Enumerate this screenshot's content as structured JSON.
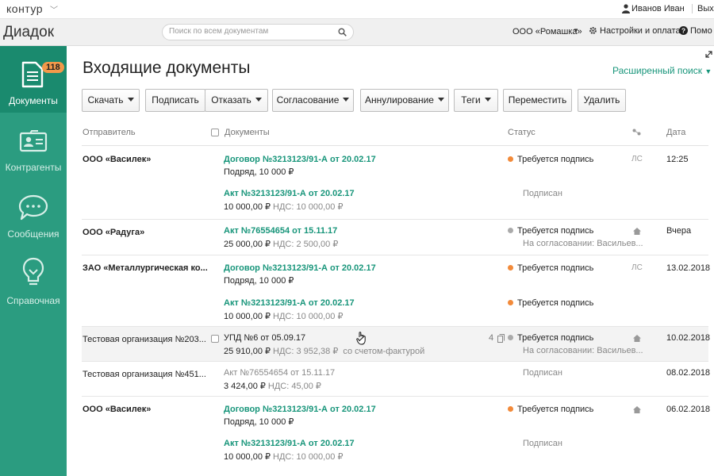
{
  "topbar": {
    "logo": "контур",
    "user_name": "Иванов Иван",
    "exit_label": "Выхо"
  },
  "appbar": {
    "brand": "Диадок",
    "search_placeholder": "Поиск по всем документам",
    "organization": "ООО «Ромашка»",
    "settings_label": "Настройки и оплата",
    "help_label": "Помо"
  },
  "sidebar": {
    "items": [
      {
        "label": "Документы",
        "badge": "118",
        "icon": "document-icon"
      },
      {
        "label": "Контрагенты",
        "icon": "id-card-icon"
      },
      {
        "label": "Сообщения",
        "icon": "chat-bubble-icon"
      },
      {
        "label": "Справочная",
        "icon": "lightbulb-icon"
      }
    ]
  },
  "page": {
    "title": "Входящие документы",
    "advanced_search": "Расширенный поиск"
  },
  "toolbar": {
    "download": "Скачать",
    "sign": "Подписать",
    "reject": "Отказать",
    "approval": "Согласование",
    "annulment": "Аннулирование",
    "tags": "Теги",
    "move": "Переместить",
    "delete": "Удалить"
  },
  "table": {
    "headers": {
      "sender": "Отправитель",
      "documents": "Документы",
      "status": "Статус",
      "date": "Дата"
    },
    "rows": [
      {
        "sender": "ООО «Василек»",
        "date": "12:25",
        "ls": "ЛС",
        "docs": [
          {
            "title": "Договор №3213123/91-А от 20.02.17",
            "sub": "Подряд, 10 000 ₽",
            "status": "Требуется подпись"
          },
          {
            "title": "Акт №3213123/91-А от 20.02.17",
            "sub": "10 000,00 ₽",
            "vat": "НДС: 10 000,00 ₽",
            "status": "Подписан"
          }
        ]
      },
      {
        "sender": "ООО «Радуга»",
        "date": "Вчера",
        "docs": [
          {
            "title": "Акт №76554654 от 15.11.17",
            "sub": "25 000,00 ₽",
            "vat": "НДС: 2 500,00 ₽",
            "status": "Требуется подпись",
            "status_sub": "На согласовании: Васильев..."
          }
        ]
      },
      {
        "sender": "ЗАО «Металлургическая ко...",
        "date": "13.02.2018",
        "ls": "ЛС",
        "docs": [
          {
            "title": "Договор №3213123/91-А от 20.02.17",
            "sub": "Подряд, 10 000 ₽",
            "status": "Требуется подпись"
          },
          {
            "title": "Акт №3213123/91-А от 20.02.17",
            "sub": "10 000,00 ₽",
            "vat": "НДС: 10 000,00 ₽",
            "status": "Требуется подпись"
          }
        ]
      },
      {
        "sender": "Тестовая организация №203...",
        "date": "10.02.2018",
        "count": "4",
        "docs": [
          {
            "title": "УПД №6 от 05.09.17",
            "sub": "25 910,00 ₽",
            "vat": "НДС: 3 952,38 ₽",
            "note": "со счетом-фактурой",
            "status": "Требуется подпись",
            "status_sub": "На согласовании: Васильев..."
          }
        ]
      },
      {
        "sender": "Тестовая организация №451...",
        "date": "08.02.2018",
        "docs": [
          {
            "title": "Акт №76554654 от 15.11.17",
            "sub": "3 424,00 ₽",
            "vat": "НДС: 45,00 ₽",
            "status": "Подписан"
          }
        ]
      },
      {
        "sender": "ООО «Василек»",
        "date": "06.02.2018",
        "docs": [
          {
            "title": "Договор №3213123/91-А от 20.02.17",
            "sub": "Подряд, 10 000 ₽",
            "status": "Требуется подпись"
          },
          {
            "title": "Акт №3213123/91-А от 20.02.17",
            "sub": "10 000,00 ₽",
            "vat": "НДС: 10 000,00 ₽",
            "status": "Подписан"
          }
        ]
      }
    ]
  },
  "colors": {
    "sidebar": "#2b9c80",
    "sidebar_active": "#1a8a6e",
    "link": "#17957a",
    "status_required": "#f28a3a",
    "badge": "#f2994a"
  }
}
